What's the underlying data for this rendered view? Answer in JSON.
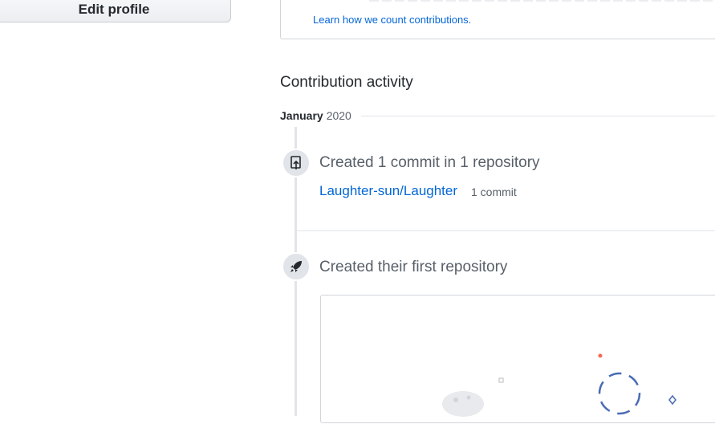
{
  "sidebar": {
    "edit_profile_label": "Edit profile"
  },
  "contributions": {
    "learn_link": "Learn how we count contributions."
  },
  "activity": {
    "title": "Contribution activity",
    "month": "January",
    "year": "2020",
    "items": [
      {
        "title": "Created 1 commit in 1 repository",
        "repo": "Laughter-sun/Laughter",
        "count": "1 commit",
        "icon": "repo-push-icon"
      },
      {
        "title": "Created their first repository",
        "icon": "rocket-icon"
      }
    ]
  },
  "colors": {
    "link": "#0366d6",
    "muted": "#586069",
    "border": "#e1e4e8",
    "accent_red": "#f66a4f",
    "accent_blue": "#4a6bb5"
  }
}
